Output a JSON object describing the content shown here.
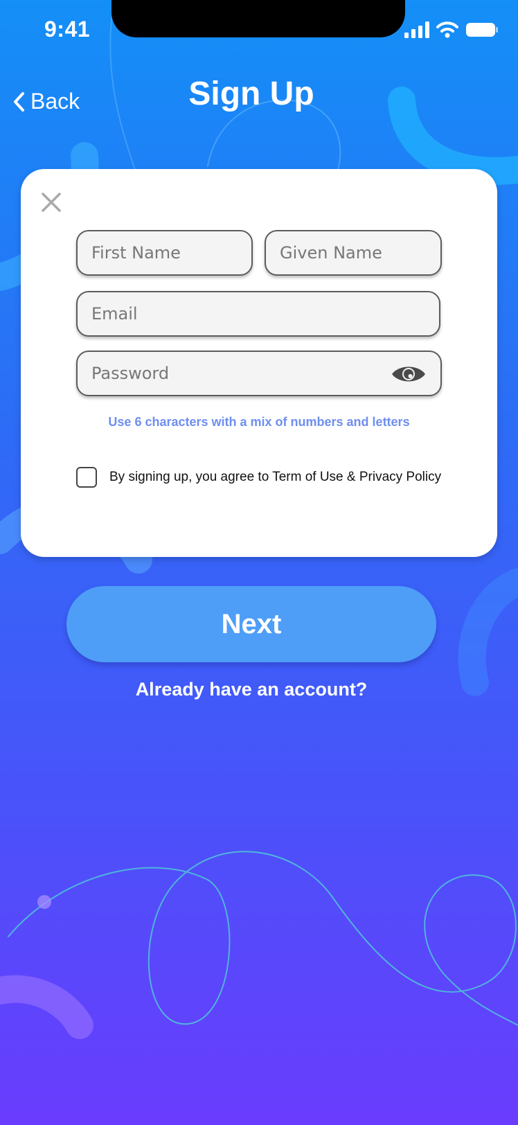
{
  "status_bar": {
    "time": "9:41",
    "icons": [
      "signal-icon",
      "wifi-icon",
      "battery-icon"
    ]
  },
  "nav": {
    "back_label": "Back",
    "back_icon": "chevron-left-icon",
    "title": "Sign Up"
  },
  "form": {
    "close_icon": "close-icon",
    "first_name": {
      "placeholder": "First Name",
      "value": ""
    },
    "given_name": {
      "placeholder": "Given Name",
      "value": ""
    },
    "email": {
      "placeholder": "Email",
      "value": ""
    },
    "password": {
      "placeholder": "Password",
      "value": "",
      "toggle_icon": "eye-icon"
    },
    "password_hint": "Use 6 characters with a mix of numbers and letters",
    "terms": {
      "checked": false,
      "label": "By signing up, you agree to Term of Use & Privacy Policy"
    }
  },
  "actions": {
    "next_label": "Next",
    "signin_link": "Already have an account?"
  },
  "colors": {
    "background_top": "#148ff7",
    "background_bottom": "#6a3cfd",
    "button": "#4e9ef8",
    "hint_text": "#6e8ef0"
  }
}
